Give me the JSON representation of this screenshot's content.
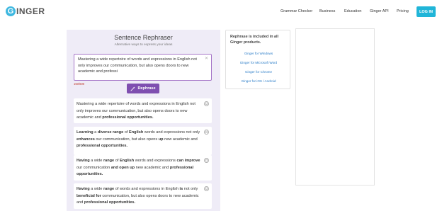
{
  "header": {
    "logo_letter": "G",
    "logo_text": "INGER",
    "nav": [
      "Grammar Checker",
      "Business",
      "Education",
      "Ginger API",
      "Pricing"
    ],
    "login_label": "LOG IN",
    "accent": "#20b5d8"
  },
  "panel": {
    "title": "Sentence Rephraser",
    "subtitle": "Alternative ways to express your ideas",
    "input_text": "Mastering a wide repertoire of words and expressions in English not only improves our communication, but also opens doors to new academic and professi",
    "counter": "150/600",
    "rephrase_label": "Rephrase",
    "button_color": "#7f4fb0"
  },
  "results": [
    {
      "segments": [
        {
          "t": "Mastering a wide repertoire of words and expressions in English not only improves our communication, but also opens doors to new academic and ",
          "b": false
        },
        {
          "t": "professional opportunities.",
          "b": true
        }
      ]
    },
    {
      "segments": [
        {
          "t": "Learning",
          "b": true
        },
        {
          "t": " a ",
          "b": false
        },
        {
          "t": "diverse range",
          "b": true
        },
        {
          "t": " of ",
          "b": false
        },
        {
          "t": "English",
          "b": true
        },
        {
          "t": " words and expressions not only ",
          "b": false
        },
        {
          "t": "enhances",
          "b": true
        },
        {
          "t": " our communication, but also opens ",
          "b": false
        },
        {
          "t": "up",
          "b": true
        },
        {
          "t": " new academic and ",
          "b": false
        },
        {
          "t": "professional opportunities.",
          "b": true
        }
      ]
    },
    {
      "segments": [
        {
          "t": "Having",
          "b": true
        },
        {
          "t": " a wide ",
          "b": false
        },
        {
          "t": "range",
          "b": true
        },
        {
          "t": " of ",
          "b": false
        },
        {
          "t": "English",
          "b": true
        },
        {
          "t": " words and expressions ",
          "b": false
        },
        {
          "t": "can improve",
          "b": true
        },
        {
          "t": " our communication ",
          "b": false
        },
        {
          "t": "and open up",
          "b": true
        },
        {
          "t": " new academic and ",
          "b": false
        },
        {
          "t": "professional opportunities.",
          "b": true
        }
      ]
    },
    {
      "segments": [
        {
          "t": "Having",
          "b": true
        },
        {
          "t": " a wide ",
          "b": false
        },
        {
          "t": "range",
          "b": true
        },
        {
          "t": " of words and expressions in English ",
          "b": false
        },
        {
          "t": "is",
          "b": true
        },
        {
          "t": " not only ",
          "b": false
        },
        {
          "t": "beneficial for",
          "b": true
        },
        {
          "t": " communication, but also opens doors to new academic and ",
          "b": false
        },
        {
          "t": "professional opportunities.",
          "b": true
        }
      ]
    }
  ],
  "promo": {
    "title": "Rephrase is included in all Ginger products.",
    "links": [
      "Ginger for Windows",
      "Ginger for Microsoft Word",
      "Ginger for Chrome",
      "Ginger for iOS / Android"
    ]
  }
}
